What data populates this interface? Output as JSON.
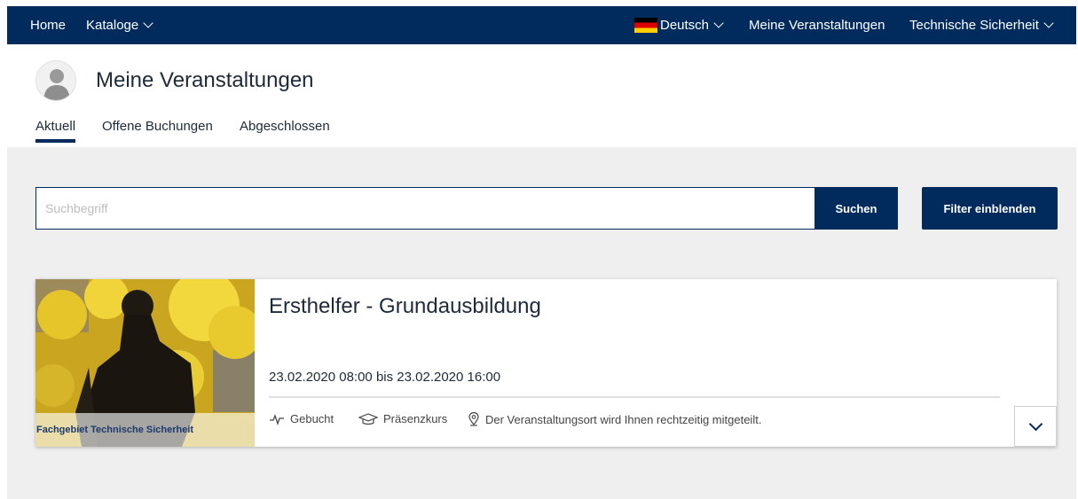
{
  "nav": {
    "home": "Home",
    "catalogs": "Kataloge",
    "language": "Deutsch",
    "my_events": "Meine Veranstaltungen",
    "org": "Technische Sicherheit"
  },
  "header": {
    "title": "Meine Veranstaltungen"
  },
  "tabs": [
    {
      "label": "Aktuell",
      "active": true
    },
    {
      "label": "Offene Buchungen",
      "active": false
    },
    {
      "label": "Abgeschlossen",
      "active": false
    }
  ],
  "search": {
    "placeholder": "Suchbegriff",
    "value": "",
    "search_button": "Suchen",
    "filter_button": "Filter einblenden"
  },
  "course": {
    "image_caption": "Fachgebiet Technische Sicherheit",
    "title": "Ersthelfer - Grundausbildung",
    "date": "23.02.2020 08:00 bis 23.02.2020 16:00",
    "status": "Gebucht",
    "type": "Präsenzkurs",
    "location": "Der Veranstaltungsort wird Ihnen rechtzeitig mitgeteilt."
  },
  "colors": {
    "primary": "#002b5c",
    "background": "#efefef"
  }
}
